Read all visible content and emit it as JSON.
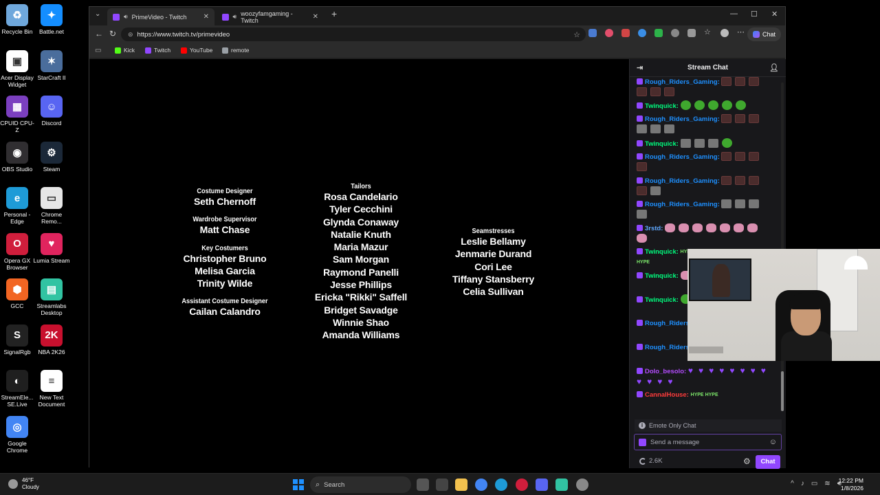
{
  "desktop": {
    "icons": [
      {
        "label": "Recycle Bin",
        "color": "#6fa8dc",
        "glyph": "♻"
      },
      {
        "label": "Battle.net",
        "color": "#148eff",
        "glyph": "✦"
      },
      {
        "label": "Acer Display Widget",
        "color": "#ffffff",
        "glyph": "▣"
      },
      {
        "label": "StarCraft II",
        "color": "#4a6d9c",
        "glyph": "✶"
      },
      {
        "label": "CPUID CPU-Z",
        "color": "#7b3fbf",
        "glyph": "▦"
      },
      {
        "label": "Discord",
        "color": "#5865f2",
        "glyph": "☺"
      },
      {
        "label": "OBS Studio",
        "color": "#302e31",
        "glyph": "◉"
      },
      {
        "label": "Steam",
        "color": "#1b2838",
        "glyph": "⚙"
      },
      {
        "label": "Personal - Edge",
        "color": "#1e9bd7",
        "glyph": "e"
      },
      {
        "label": "Chrome Remo...",
        "color": "#e6e6e6",
        "glyph": "▭"
      },
      {
        "label": "Opera GX Browser",
        "color": "#d01e3c",
        "glyph": "O"
      },
      {
        "label": "Lumia Stream",
        "color": "#e0245e",
        "glyph": "♥"
      },
      {
        "label": "GCC",
        "color": "#f26522",
        "glyph": "⬢"
      },
      {
        "label": "Streamlabs Desktop",
        "color": "#31c3a2",
        "glyph": "▤"
      },
      {
        "label": "SignalRgb",
        "color": "#222222",
        "glyph": "S"
      },
      {
        "label": "NBA 2K26",
        "color": "#c8102e",
        "glyph": "2K"
      },
      {
        "label": "StreamEle... SE.Live",
        "color": "#1f1f1f",
        "glyph": "◐"
      },
      {
        "label": "New Text Document",
        "color": "#ffffff",
        "glyph": "≡"
      },
      {
        "label": "Google Chrome",
        "color": "#4285f4",
        "glyph": "◎"
      }
    ]
  },
  "browser": {
    "tabs": [
      {
        "title": "PrimeVideo - Twitch",
        "active": true
      },
      {
        "title": "woozyfamgaming - Twitch",
        "active": false
      }
    ],
    "new_tab": "+",
    "url": "https://www.twitch.tv/primevideo",
    "copilot_label": "Chat",
    "bookmarks": [
      {
        "label": "Kick",
        "color": "#53fc18"
      },
      {
        "label": "Twitch",
        "color": "#9147ff"
      },
      {
        "label": "YouTube",
        "color": "#ff0000"
      },
      {
        "label": "remote",
        "color": "#9aa0a6"
      }
    ]
  },
  "credits": {
    "col1": [
      {
        "role": "Costume Designer",
        "names": [
          "Seth Chernoff"
        ]
      },
      {
        "role": "Wardrobe Supervisor",
        "names": [
          "Matt Chase"
        ]
      },
      {
        "role": "Key Costumers",
        "names": [
          "Christopher Bruno",
          "Melisa Garcia",
          "Trinity Wilde"
        ]
      },
      {
        "role": "Assistant Costume Designer",
        "names": [
          "Cailan Calandro"
        ]
      }
    ],
    "col2": [
      {
        "role": "Tailors",
        "names": [
          "Rosa Candelario",
          "Tyler Cecchini",
          "Glynda Conaway",
          "Natalie Knuth",
          "Maria Mazur",
          "Sam Morgan",
          "Raymond Panelli",
          "Jesse Phillips",
          "Ericka \"Rikki\" Saffell",
          "Bridget Savadge",
          "Winnie Shao",
          "Amanda Williams"
        ]
      }
    ],
    "col3": [
      {
        "role": "Seamstresses",
        "names": [
          "Leslie Bellamy",
          "Jenmarie Durand",
          "Cori Lee",
          "Tiffany Stansberry",
          "Celia Sullivan"
        ]
      }
    ]
  },
  "chat": {
    "title": "Stream Chat",
    "messages": [
      {
        "user": "Rough_Riders_Gaming:",
        "color": "#1e90ff"
      },
      {
        "user": "Twinquick:",
        "color": "#00ff7f"
      },
      {
        "user": "Rough_Riders_Gaming:",
        "color": "#1e90ff"
      },
      {
        "user": "Twinquick:",
        "color": "#00ff7f"
      },
      {
        "user": "Rough_Riders_Gaming:",
        "color": "#1e90ff"
      },
      {
        "user": "Rough_Riders_Gaming:",
        "color": "#1e90ff"
      },
      {
        "user": "Rough_Riders_Gaming:",
        "color": "#1e90ff"
      },
      {
        "user": "3rstd:",
        "color": "#5fa8ff"
      },
      {
        "user": "Twinquick:",
        "color": "#00ff7f"
      },
      {
        "user": "Twinquick:",
        "color": "#00ff7f"
      },
      {
        "user": "Twinquick:",
        "color": "#00ff7f"
      },
      {
        "user": "Rough_Riders",
        "color": "#1e90ff"
      },
      {
        "user": "Rough_Riders",
        "color": "#1e90ff"
      },
      {
        "user": "Dolo_besolo:",
        "color": "#b44cff"
      },
      {
        "user": "CannalHouse:",
        "color": "#ff3b3b"
      }
    ],
    "emote_only_label": "Emote Only Chat",
    "input_placeholder": "Send a message",
    "points": "2.6K",
    "send_label": "Chat"
  },
  "taskbar": {
    "temp": "46°F",
    "condition": "Cloudy",
    "search_label": "Search",
    "time": "12:22 PM",
    "date": "1/8/2026"
  }
}
